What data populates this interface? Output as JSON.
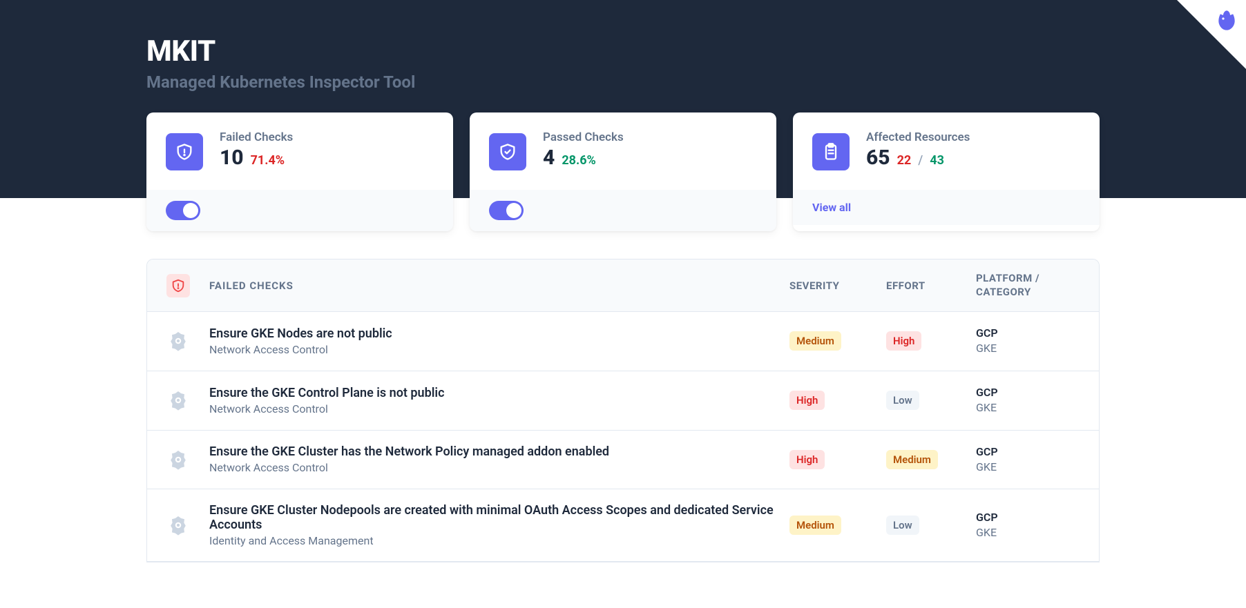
{
  "header": {
    "title": "MKIT",
    "subtitle": "Managed Kubernetes Inspector Tool"
  },
  "cards": {
    "failed": {
      "label": "Failed Checks",
      "value": "10",
      "pct": "71.4%"
    },
    "passed": {
      "label": "Passed Checks",
      "value": "4",
      "pct": "28.6%"
    },
    "affected": {
      "label": "Affected Resources",
      "value": "65",
      "red": "22",
      "slash": "/",
      "green": "43",
      "view_all": "View all"
    }
  },
  "table": {
    "title": "FAILED CHECKS",
    "cols": {
      "severity": "SEVERITY",
      "effort": "EFFORT",
      "platform": "PLATFORM / CATEGORY"
    },
    "rows": [
      {
        "title": "Ensure GKE Nodes are not public",
        "sub": "Network Access Control",
        "severity": "Medium",
        "effort": "High",
        "platform": "GCP",
        "category": "GKE"
      },
      {
        "title": "Ensure the GKE Control Plane is not public",
        "sub": "Network Access Control",
        "severity": "High",
        "effort": "Low",
        "platform": "GCP",
        "category": "GKE"
      },
      {
        "title": "Ensure the GKE Cluster has the Network Policy managed addon enabled",
        "sub": "Network Access Control",
        "severity": "High",
        "effort": "Medium",
        "platform": "GCP",
        "category": "GKE"
      },
      {
        "title": "Ensure GKE Cluster Nodepools are created with minimal OAuth Access Scopes and dedicated Service Accounts",
        "sub": "Identity and Access Management",
        "severity": "Medium",
        "effort": "Low",
        "platform": "GCP",
        "category": "GKE"
      }
    ]
  }
}
